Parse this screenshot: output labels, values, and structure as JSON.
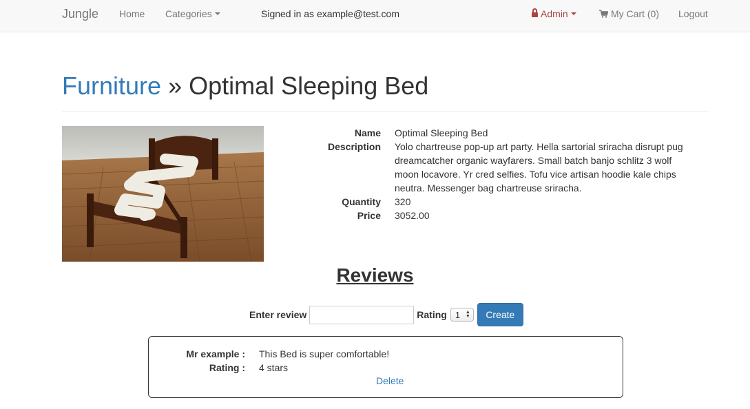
{
  "navbar": {
    "brand": "Jungle",
    "home": "Home",
    "categories": "Categories",
    "signed_in": "Signed in as example@test.com",
    "admin": "Admin",
    "cart": "My Cart (0)",
    "logout": "Logout"
  },
  "heading": {
    "category": "Furniture",
    "separator": " » ",
    "product": "Optimal Sleeping Bed"
  },
  "product": {
    "labels": {
      "name": "Name",
      "description": "Description",
      "quantity": "Quantity",
      "price": "Price"
    },
    "name": "Optimal Sleeping Bed",
    "description": "Yolo chartreuse pop-up art party. Hella sartorial sriracha disrupt pug dreamcatcher organic wayfarers. Small batch banjo schlitz 3 wolf moon locavore. Yr cred selfies. Tofu vice artisan hoodie kale chips neutra. Messenger bag chartreuse sriracha.",
    "quantity": "320",
    "price": "3052.00"
  },
  "reviews": {
    "title": "Reviews",
    "form": {
      "enter_label": "Enter review",
      "review_value": "",
      "rating_label": "Rating",
      "rating_selected": "1",
      "create_label": "Create"
    },
    "items": [
      {
        "author_label": "Mr example :",
        "text": "This Bed is super comfortable!",
        "rating_label": "Rating :",
        "rating": "4 stars",
        "delete_label": "Delete"
      }
    ]
  },
  "colors": {
    "link": "#337ab7",
    "admin": "#a94442",
    "navbar_bg": "#f8f8f8",
    "button": "#337ab7"
  }
}
